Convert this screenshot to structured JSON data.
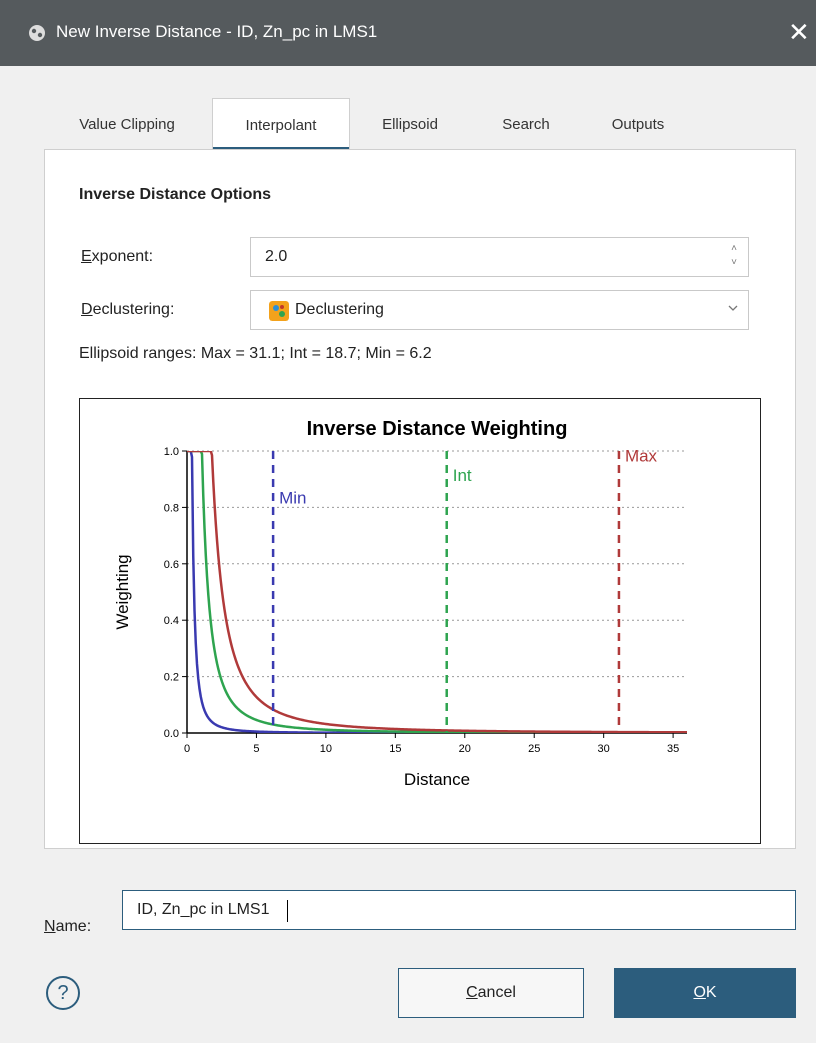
{
  "window": {
    "title": "New Inverse Distance - ID, Zn_pc in LMS1",
    "close_glyph": "✕",
    "icon": "app-icon"
  },
  "tabs": [
    {
      "label": "Value Clipping",
      "active": false
    },
    {
      "label": "Interpolant",
      "active": true
    },
    {
      "label": "Ellipsoid",
      "active": false
    },
    {
      "label": "Search",
      "active": false
    },
    {
      "label": "Outputs",
      "active": false
    }
  ],
  "options": {
    "section_title": "Inverse Distance Options",
    "exponent_label_first": "E",
    "exponent_label_rest": "xponent:",
    "exponent_value": "2.0",
    "declustering_label_first": "D",
    "declustering_label_rest": "eclustering:",
    "declustering_value": "Declustering",
    "ellipsoid_ranges": "Ellipsoid ranges:  Max = 31.1; Int = 18.7; Min = 6.2"
  },
  "chart_data": {
    "type": "line",
    "title": "Inverse Distance Weighting",
    "xlabel": "Distance",
    "ylabel": "Weighting",
    "xlim": [
      0,
      36
    ],
    "ylim": [
      0,
      1.0
    ],
    "x_ticks": [
      "0",
      "5",
      "10",
      "15",
      "20",
      "25",
      "30",
      "35"
    ],
    "y_ticks": [
      "0.0",
      "0.2",
      "0.4",
      "0.6",
      "0.8",
      "1.0"
    ],
    "exponent": 2.0,
    "grid": "horizontal-dotted",
    "series": [
      {
        "range_value": 6.2,
        "color": "#3a3ab0"
      },
      {
        "range_value": 18.7,
        "color": "#2ea44f"
      },
      {
        "range_value": 31.1,
        "color": "#b03a3a"
      }
    ],
    "markers": [
      {
        "label": "Min",
        "x": 6.2,
        "color": "#3a3ab0"
      },
      {
        "label": "Int",
        "x": 18.7,
        "color": "#2ea44f"
      },
      {
        "label": "Max",
        "x": 31.1,
        "color": "#b03a3a"
      }
    ]
  },
  "name_field": {
    "label_first": "N",
    "label_rest": "ame:",
    "value": "ID, Zn_pc in LMS1"
  },
  "buttons": {
    "help_glyph": "?",
    "cancel_first": "C",
    "cancel_rest": "ancel",
    "ok_first": "O",
    "ok_rest": "K"
  },
  "colors": {
    "accent": "#2c5d7d",
    "titlebar": "#555a5d"
  }
}
